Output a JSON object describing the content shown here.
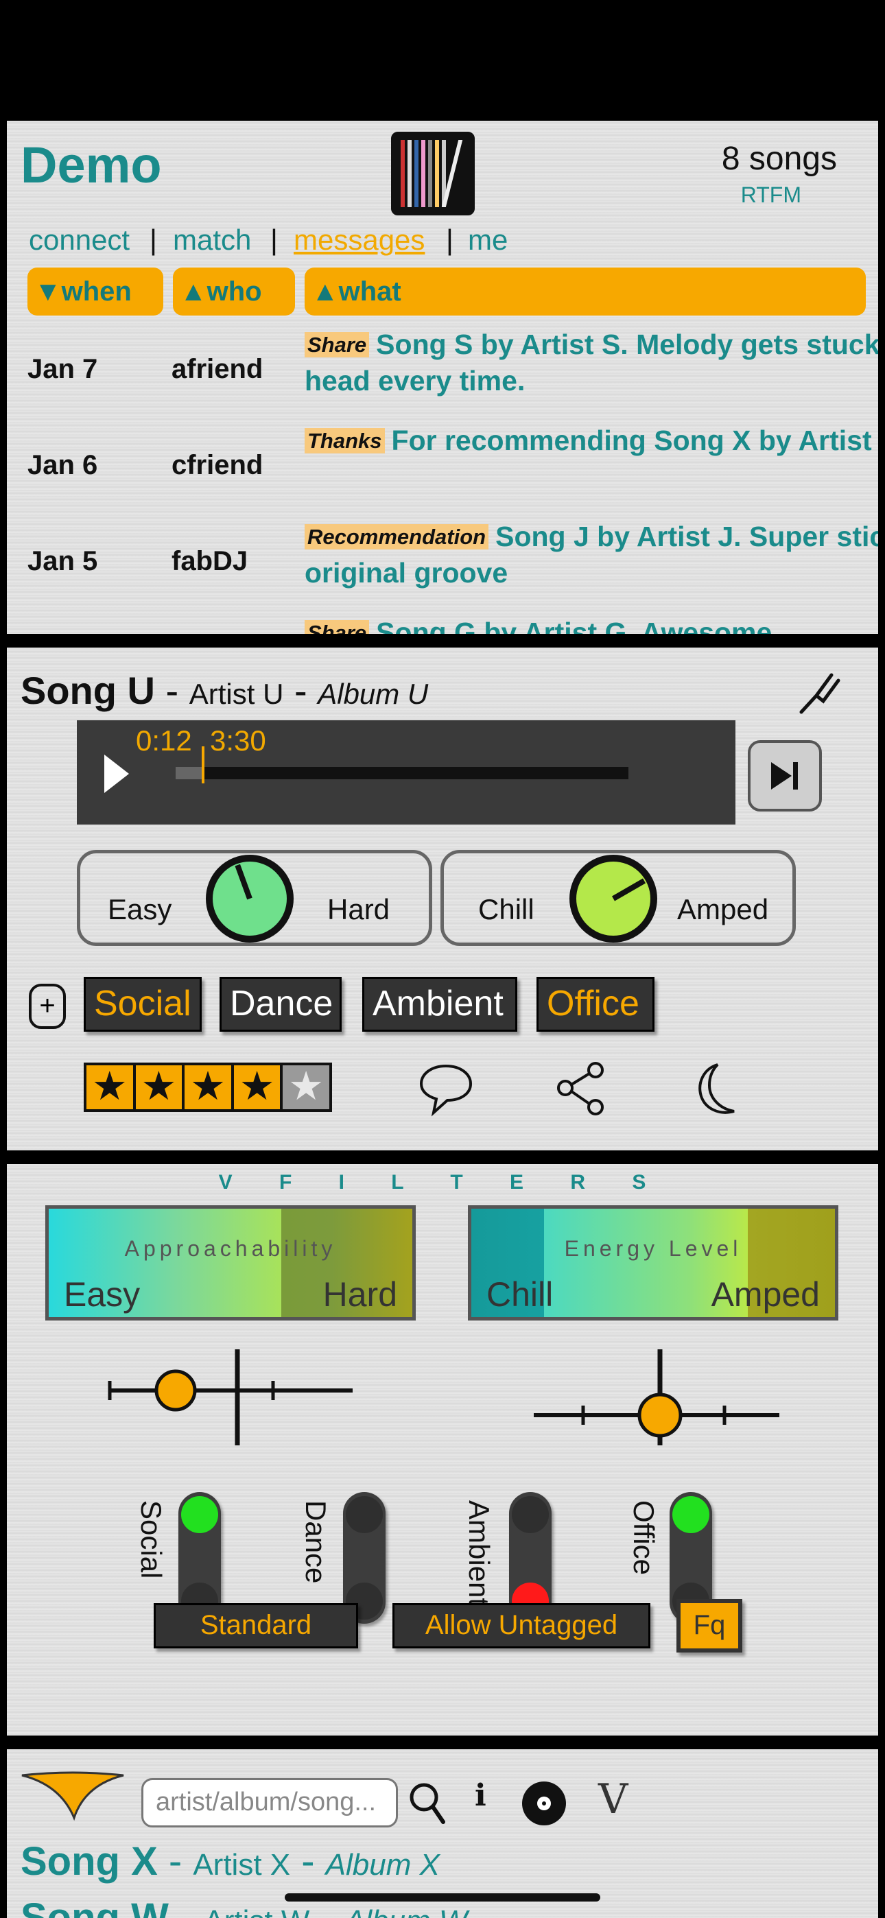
{
  "header": {
    "title": "Demo",
    "song_count": "8 songs",
    "rtfm": "RTFM"
  },
  "nav": [
    {
      "label": "connect"
    },
    {
      "label": "match"
    },
    {
      "label": "messages",
      "active": true
    },
    {
      "label": "me"
    }
  ],
  "nav_sep": "|",
  "columns": {
    "when": "▼when",
    "who": "▲who",
    "what": "▲what"
  },
  "messages": [
    {
      "date": "Jan 7",
      "who": "afriend",
      "tag": "Share",
      "text": "Song S by Artist S. Melody gets stuck in my head every time."
    },
    {
      "date": "Jan 6",
      "who": "cfriend",
      "tag": "Thanks",
      "text": "For recommending Song X by Artist X."
    },
    {
      "date": "Jan 5",
      "who": "fabDJ",
      "tag": "Recommendation",
      "text": "Song J by Artist J. Super sticky original groove"
    },
    {
      "date": "",
      "who": "",
      "tag": "Share",
      "text": "Song G by Artist G. Awesome"
    }
  ],
  "player": {
    "song": "Song U",
    "artist": "Artist U",
    "album": "Album U",
    "dash": "-",
    "elapsed": "0:12",
    "duration": "3:30",
    "progress": 0.057
  },
  "knobs": [
    {
      "lo": "Easy",
      "hi": "Hard",
      "color": "#6fe08c",
      "angle": -20
    },
    {
      "lo": "Chill",
      "hi": "Amped",
      "color": "#b4e84a",
      "angle": 60
    }
  ],
  "genres": [
    {
      "label": "Social",
      "on": true
    },
    {
      "label": "Dance",
      "on": false
    },
    {
      "label": "Ambient",
      "on": false
    },
    {
      "label": "Office",
      "on": true
    }
  ],
  "add_genre": "+",
  "rating": {
    "value": 4,
    "max": 5
  },
  "filters": {
    "title": "V F I L T E R S",
    "bars": [
      {
        "label": "Approachability",
        "lo": "Easy",
        "hi": "Hard"
      },
      {
        "label": "Energy Level",
        "lo": "Chill",
        "hi": "Amped"
      }
    ],
    "toggles": [
      {
        "label": "Social",
        "state": "on"
      },
      {
        "label": "Dance",
        "state": "off"
      },
      {
        "label": "Ambient",
        "state": "excluded"
      },
      {
        "label": "Office",
        "state": "on"
      }
    ],
    "buttons": {
      "standard": "Standard",
      "untagged": "Allow Untagged",
      "fq": "Fq"
    }
  },
  "library": {
    "search_placeholder": "artist/album/song...",
    "info": "i",
    "v": "V",
    "songs": [
      {
        "song": "Song X",
        "artist": "Artist X",
        "album": "Album X"
      },
      {
        "song": "Song W",
        "artist": "Artist W",
        "album": "Album W"
      }
    ]
  },
  "colors": {
    "accent": "#f7a800",
    "teal": "#1a8b8b",
    "on": "#22e01f",
    "excluded": "#ff1a1a"
  }
}
